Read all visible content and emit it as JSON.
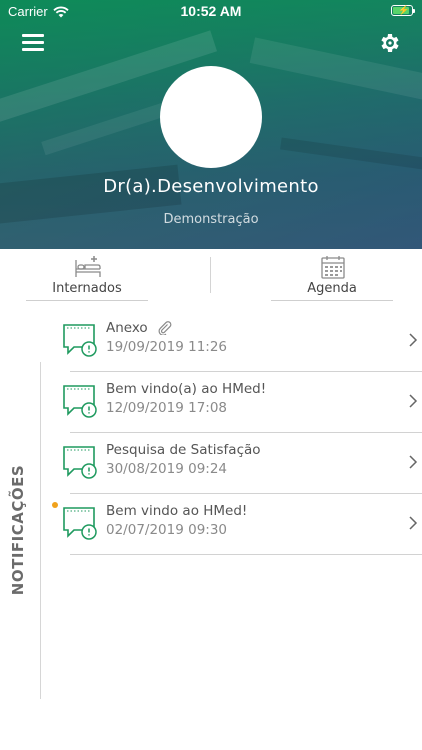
{
  "status_bar": {
    "carrier": "Carrier",
    "time": "10:52 AM"
  },
  "header": {
    "menu_icon": "hamburger-menu-icon",
    "settings_icon": "gear-icon",
    "user_name": "Dr(a).Desenvolvimento",
    "user_role": "Demonstração"
  },
  "shortcuts": [
    {
      "label": "Internados",
      "icon": "hospital-bed-icon"
    },
    {
      "label": "Agenda",
      "icon": "calendar-icon"
    }
  ],
  "notifications": {
    "section_label": "NOTIFICAÇÕES",
    "items": [
      {
        "title": "Anexo",
        "date": "19/09/2019 11:26",
        "has_attachment": true,
        "unread": false
      },
      {
        "title": "Bem vindo(a) ao HMed!",
        "date": "12/09/2019 17:08",
        "has_attachment": false,
        "unread": false
      },
      {
        "title": "Pesquisa de Satisfação",
        "date": "30/08/2019 09:24",
        "has_attachment": false,
        "unread": false
      },
      {
        "title": "Bem vindo ao HMed!",
        "date": "02/07/2019 09:30",
        "has_attachment": false,
        "unread": true
      }
    ]
  },
  "colors": {
    "accent_green": "#1f9a5f",
    "unread_dot": "#f0a21c",
    "battery_charge": "#58d36b"
  }
}
